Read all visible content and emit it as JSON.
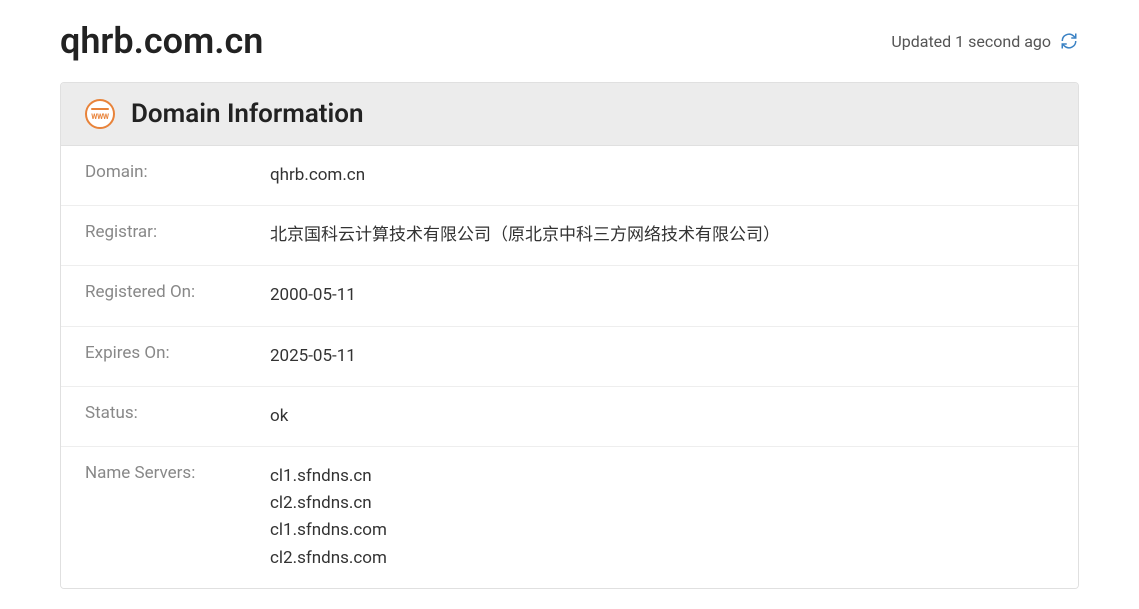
{
  "title": "qhrb.com.cn",
  "updated_text": "Updated 1 second ago",
  "panel_title": "Domain Information",
  "labels": {
    "domain": "Domain:",
    "registrar": "Registrar:",
    "registered_on": "Registered On:",
    "expires_on": "Expires On:",
    "status": "Status:",
    "name_servers": "Name Servers:"
  },
  "values": {
    "domain": "qhrb.com.cn",
    "registrar": "北京国科云计算技术有限公司（原北京中科三方网络技术有限公司）",
    "registered_on": "2000-05-11",
    "expires_on": "2025-05-11",
    "status": "ok",
    "name_servers": [
      "cl1.sfndns.cn",
      "cl2.sfndns.cn",
      "cl1.sfndns.com",
      "cl2.sfndns.com"
    ]
  }
}
